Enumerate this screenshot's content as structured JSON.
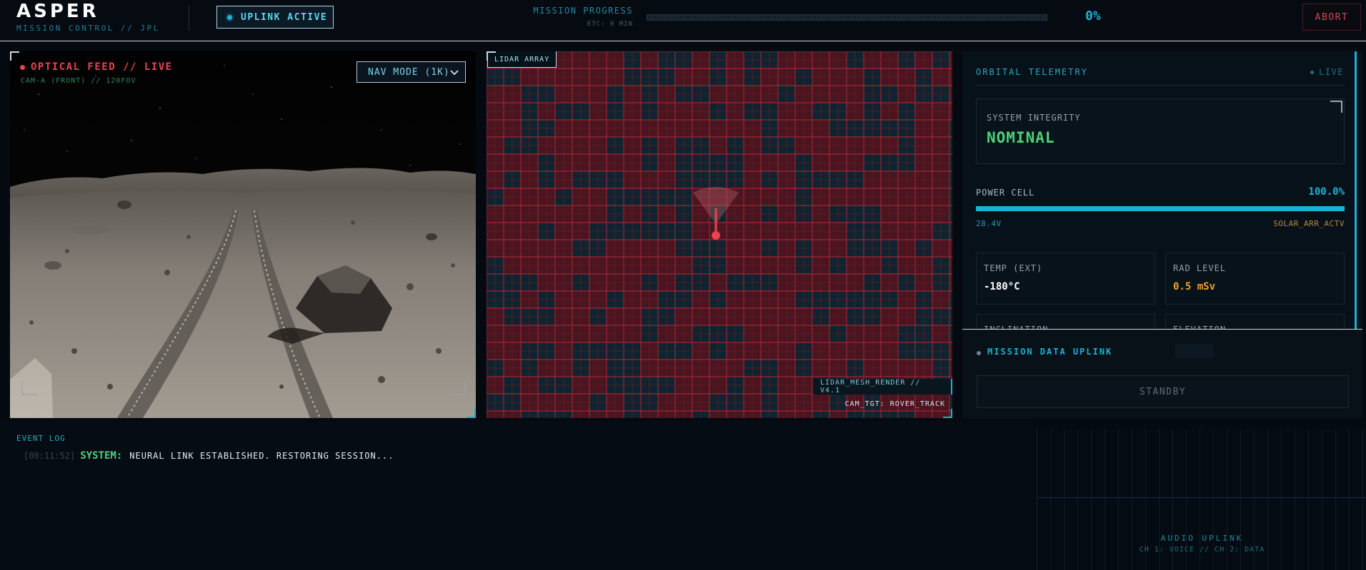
{
  "brand": {
    "title": "ASPER",
    "subtitle": "MISSION CONTROL // JPL"
  },
  "header": {
    "uplink_button": "UPLINK ACTIVE",
    "mission_progress_label": "MISSION PROGRESS",
    "mission_etc": "ETC: 0 MIN",
    "mission_progress_fraction": 0,
    "mission_progress_text": "0%",
    "abort_button": "ABORT"
  },
  "optical": {
    "title": "OPTICAL FEED // LIVE",
    "subtitle": "CAM-A (FRONT) // 120FOV",
    "nav_mode": "NAV MODE (1K)"
  },
  "lidar": {
    "tag": "LIDAR ARRAY",
    "mesh_label": "LIDAR_MESH_RENDER // V4.1",
    "cam_target": "CAM_TGT: ROVER_TRACK"
  },
  "telemetry": {
    "title": "ORBITAL TELEMETRY",
    "live": "LIVE",
    "system_integrity_label": "SYSTEM INTEGRITY",
    "system_integrity_value": "NOMINAL",
    "power_label": "POWER CELL",
    "power_value": "100.0%",
    "power_fraction": 1.0,
    "power_voltage": "28.4V",
    "power_mode": "SOLAR_ARR_ACTV",
    "cards": [
      {
        "label": "TEMP (EXT)",
        "value": "-180°C",
        "color": "#ffffff"
      },
      {
        "label": "RAD LEVEL",
        "value": "0.5 mSv",
        "color": "#f0a02a"
      },
      {
        "label": "INCLINATION",
        "value": "",
        "color": "#ffffff"
      },
      {
        "label": "ELEVATION",
        "value": "",
        "color": "#ffffff"
      }
    ]
  },
  "uplink_panel": {
    "title": "MISSION DATA UPLINK",
    "button": "STANDBY"
  },
  "event_log": {
    "title": "EVENT LOG",
    "entries": [
      {
        "time": "[00:11:52]",
        "source": "SYSTEM:",
        "message": "NEURAL LINK ESTABLISHED. RESTORING SESSION..."
      }
    ]
  },
  "audio": {
    "title": "AUDIO UPLINK",
    "subtitle": "CH 1: VOICE // CH 2: DATA"
  },
  "colors": {
    "accent": "#19b3d6",
    "alert": "#e8434f",
    "ok": "#4fd07a",
    "warn": "#f0a02a"
  },
  "icons": {
    "uplink": "status-dot",
    "nav_mode": "chevron-down-icon",
    "live": "live-dot",
    "target": "target-pin-icon"
  }
}
